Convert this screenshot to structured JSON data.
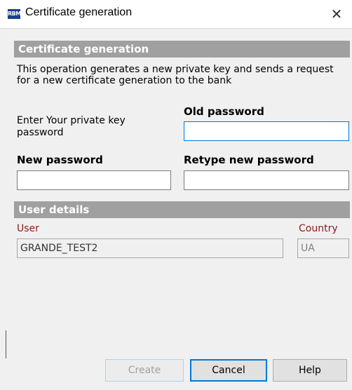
{
  "window": {
    "title": "Certificate generation",
    "icon_label": "RBM"
  },
  "cert_section": {
    "header": "Certificate generation",
    "description": "This operation generates a new private key and sends a request for a new certificate generation to the bank"
  },
  "password_form": {
    "enter_key_label": "Enter Your private key password",
    "old_password_label": "Old password",
    "old_password_value": "",
    "new_password_label": "New password",
    "new_password_value": "",
    "retype_password_label": "Retype new password",
    "retype_password_value": ""
  },
  "user_section": {
    "header": "User details",
    "user_label": "User",
    "user_value": "GRANDE_TEST2",
    "country_label": "Country",
    "country_value": "UA"
  },
  "buttons": {
    "create": "Create",
    "cancel": "Cancel",
    "help": "Help"
  },
  "colors": {
    "section_header_bg": "#a0a0a0",
    "accent": "#0078d7",
    "label_red": "#8b1a1a"
  }
}
